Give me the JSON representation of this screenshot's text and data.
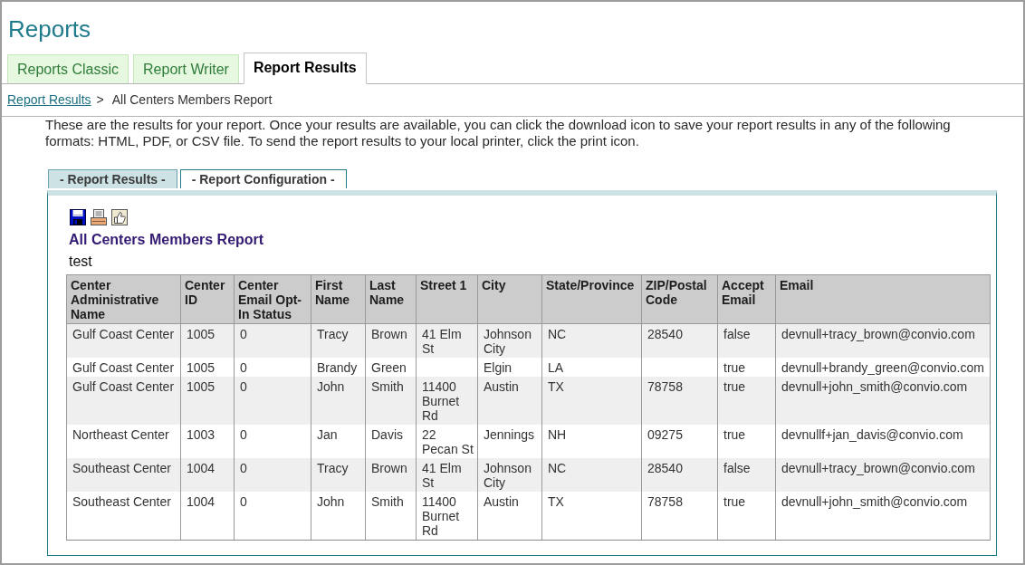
{
  "page_title": "Reports",
  "tabs": [
    {
      "label": "Reports Classic",
      "selected": false
    },
    {
      "label": "Report Writer",
      "selected": false
    },
    {
      "label": "Report Results",
      "selected": true
    }
  ],
  "breadcrumb": {
    "link": "Report Results",
    "separator": ">",
    "current": "All Centers Members Report"
  },
  "intro": "These are the results for your report. Once your results are available, you can click the download icon to save your report results in any of the following formats: HTML, PDF, or CSV file. To send the report results to your local printer, click the print icon.",
  "sub_tabs": [
    {
      "label": "- Report Results -",
      "selected": true
    },
    {
      "label": "- Report Configuration -",
      "selected": false
    }
  ],
  "report": {
    "title": "All Centers Members Report",
    "description": "test",
    "table": {
      "columns": [
        "Center Administrative Name",
        "Center ID",
        "Center Email Opt-In Status",
        "First Name",
        "Last Name",
        "Street 1",
        "City",
        "State/Province",
        "ZIP/Postal Code",
        "Accept Email",
        "Email"
      ],
      "rows": [
        [
          "Gulf Coast Center",
          "1005",
          "0",
          "Tracy",
          "Brown",
          "41 Elm St",
          "Johnson City",
          "NC",
          "28540",
          "false",
          "devnull+tracy_brown@convio.com"
        ],
        [
          "Gulf Coast Center",
          "1005",
          "0",
          "Brandy",
          "Green",
          null,
          "Elgin",
          "LA",
          null,
          "true",
          "devnull+brandy_green@convio.com"
        ],
        [
          "Gulf Coast Center",
          "1005",
          "0",
          "John",
          "Smith",
          "11400 Burnet Rd",
          "Austin",
          "TX",
          "78758",
          "true",
          "devnull+john_smith@convio.com"
        ],
        [
          "Northeast Center",
          "1003",
          "0",
          "Jan",
          "Davis",
          "22 Pecan St",
          "Jennings",
          "NH",
          "09275",
          "true",
          "devnullf+jan_davis@convio.com"
        ],
        [
          "Southeast Center",
          "1004",
          "0",
          "Tracy",
          "Brown",
          "41 Elm St",
          "Johnson City",
          "NC",
          "28540",
          "false",
          "devnull+tracy_brown@convio.com"
        ],
        [
          "Southeast Center",
          "1004",
          "0",
          "John",
          "Smith",
          "11400 Burnet Rd",
          "Austin",
          "TX",
          "78758",
          "true",
          "devnull+john_smith@convio.com"
        ]
      ]
    }
  }
}
